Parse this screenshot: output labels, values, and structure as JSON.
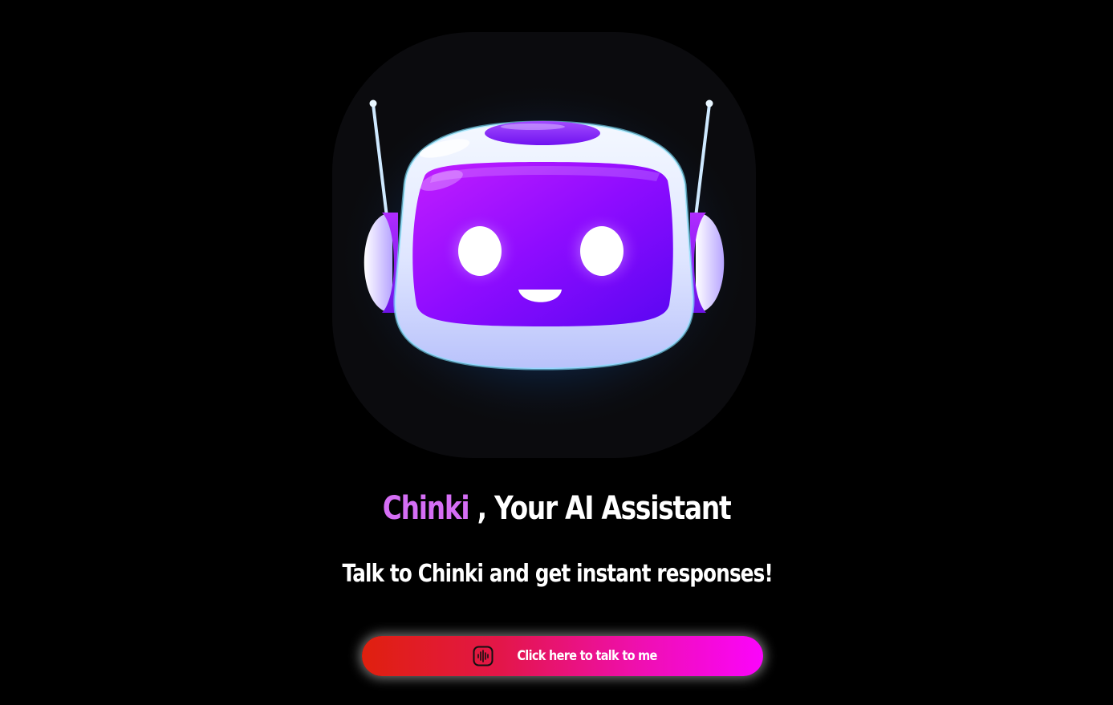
{
  "hero": {
    "image_alt": "Chinki robot",
    "title_brand": "Chinki",
    "title_rest": " , Your AI Assistant",
    "subtitle": "Talk to Chinki and get instant responses!"
  },
  "cta": {
    "label": "Click here to talk to me",
    "icon": "voice-waveform-icon"
  },
  "colors": {
    "background": "#000000",
    "brand": "#d56ef5",
    "button_start": "#e0200e",
    "button_end": "#fb05fb"
  }
}
